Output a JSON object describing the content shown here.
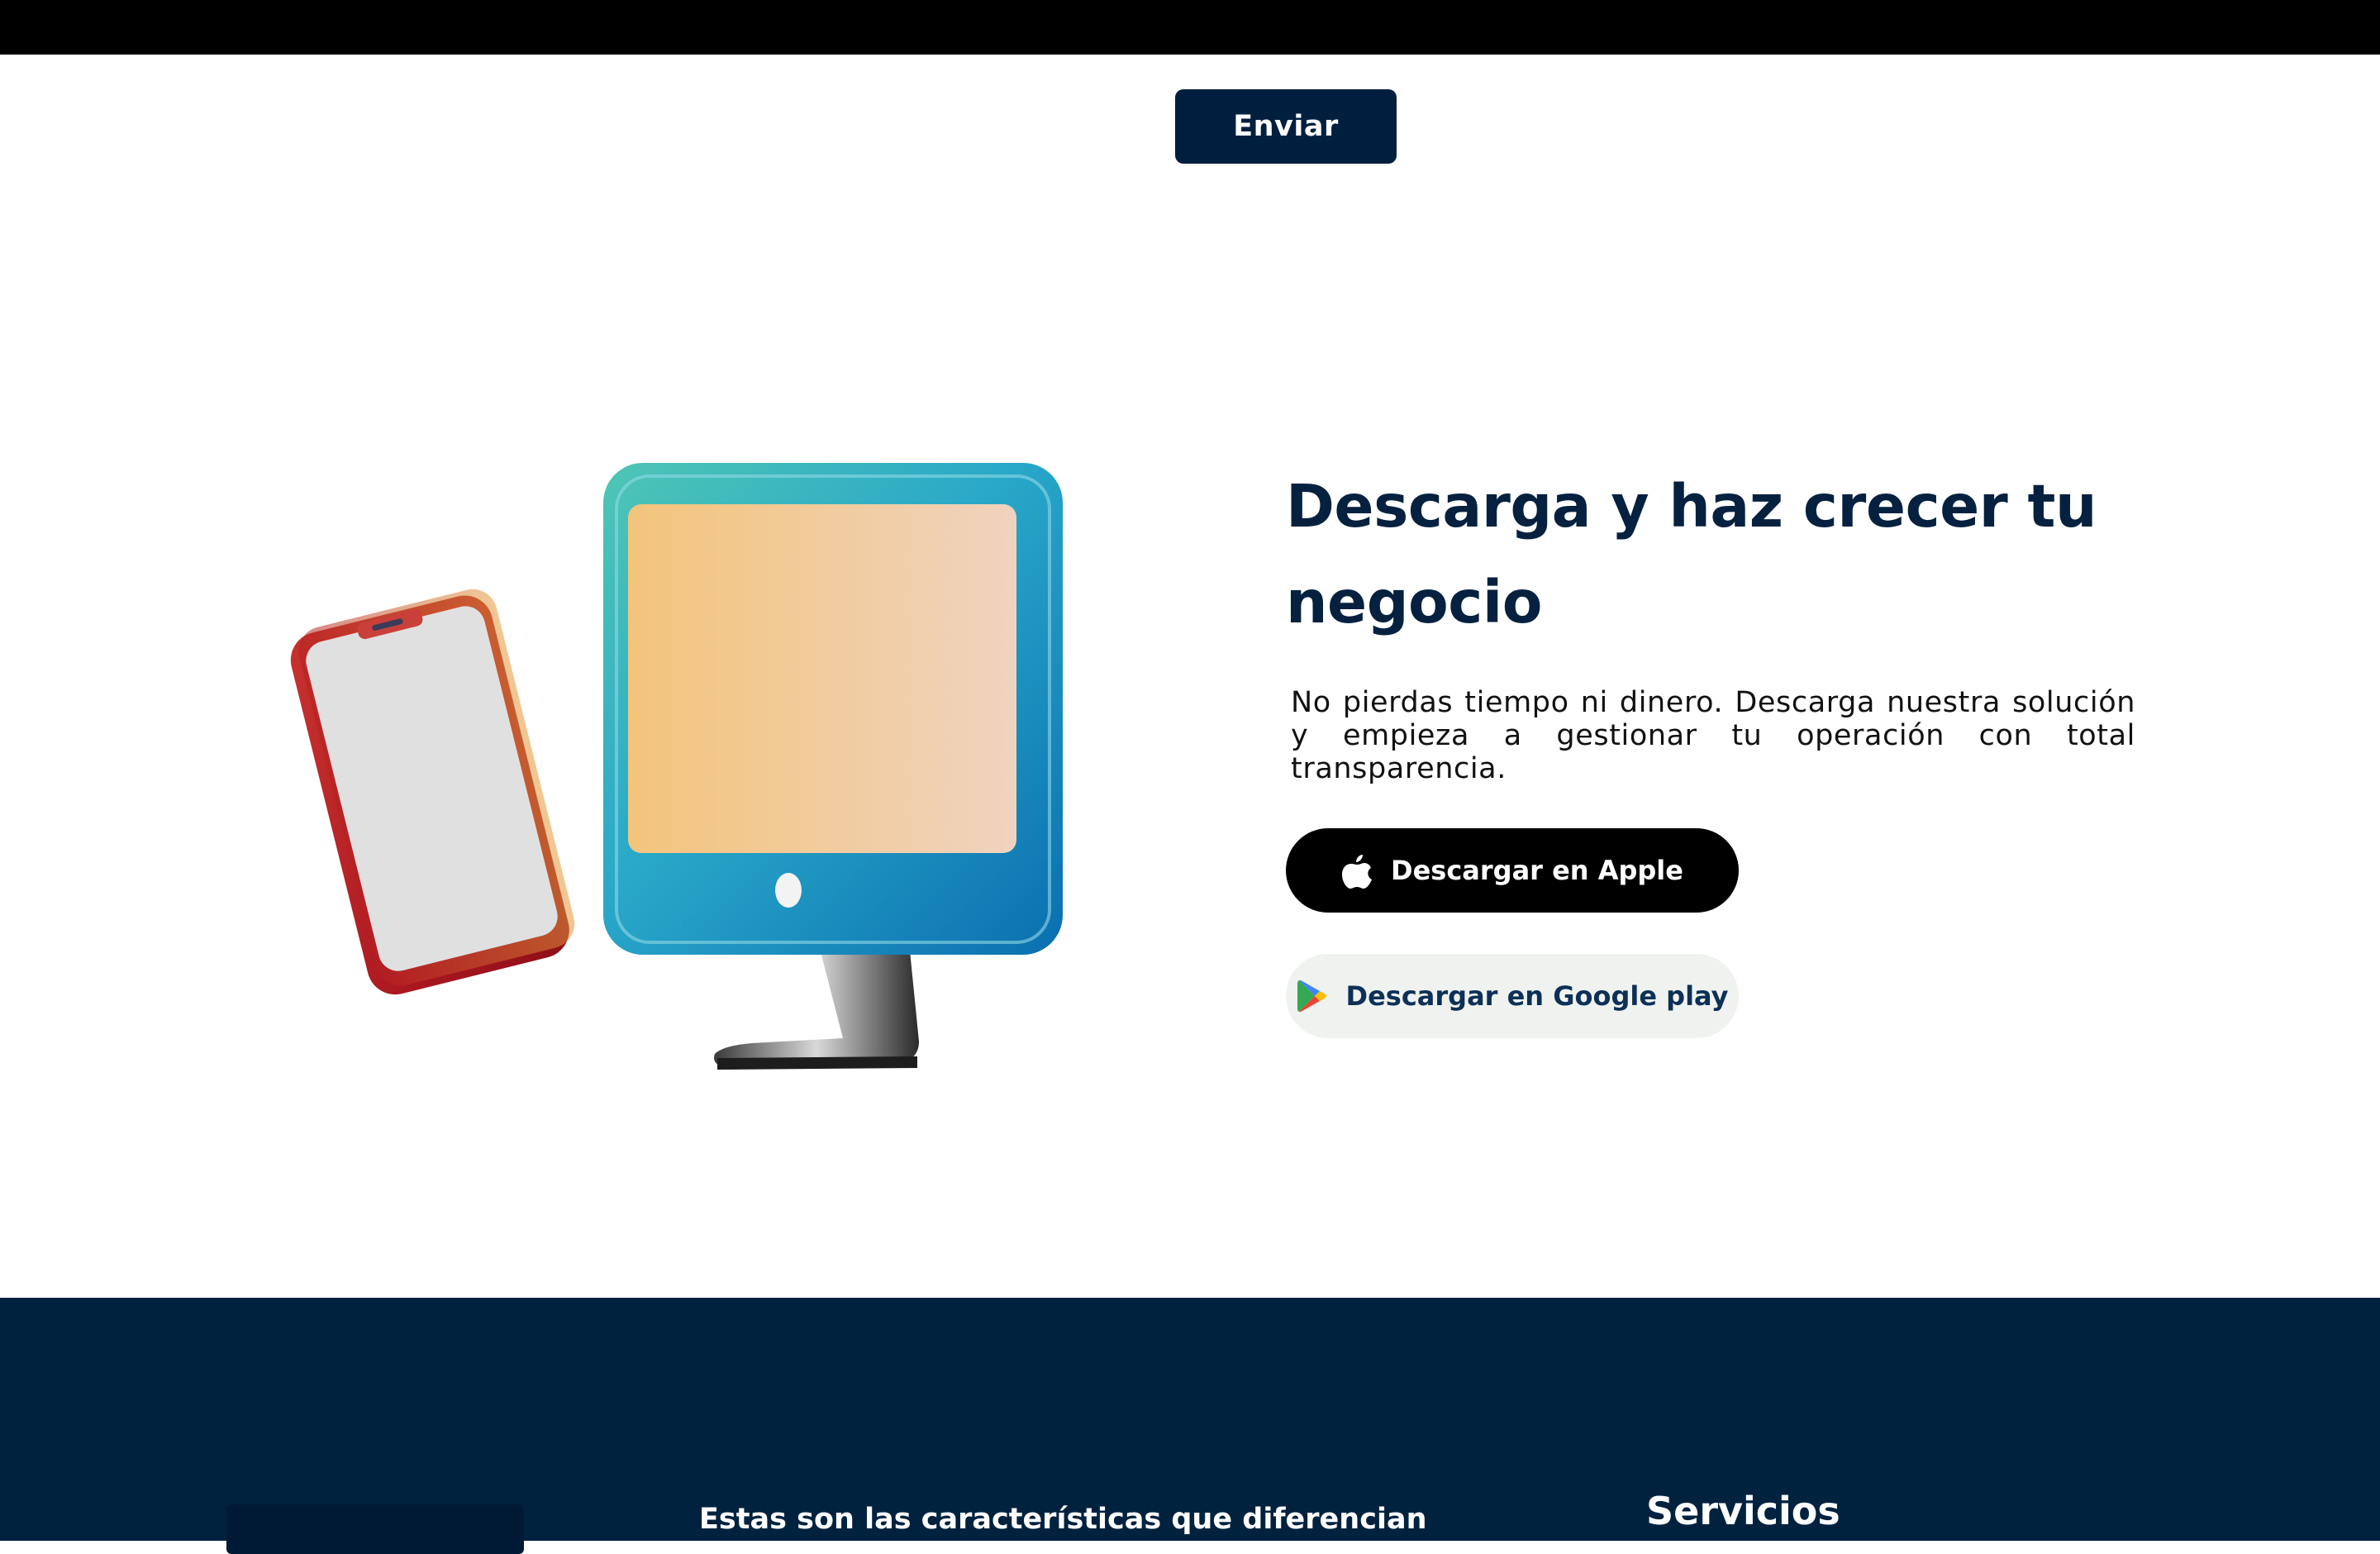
{
  "form": {
    "submit_label": "Enviar"
  },
  "download": {
    "headline": "Descarga y haz crecer tu negocio",
    "description": "No pierdas tiempo ni dinero. Descarga nuestra solución y empieza a gestionar tu operación con total transparencia.",
    "apple_label": "Descargar en Apple",
    "google_label": "Descargar en Google play",
    "apple_icon": "apple-icon",
    "google_icon": "google-play-icon"
  },
  "illustration": {
    "name": "phone-and-monitor-illustration"
  },
  "footer": {
    "tagline": "Estas son las características que diferencian",
    "services_title": "Servicios"
  },
  "colors": {
    "navy": "#001f3f",
    "black": "#000000",
    "light_button": "#eff2ef"
  }
}
